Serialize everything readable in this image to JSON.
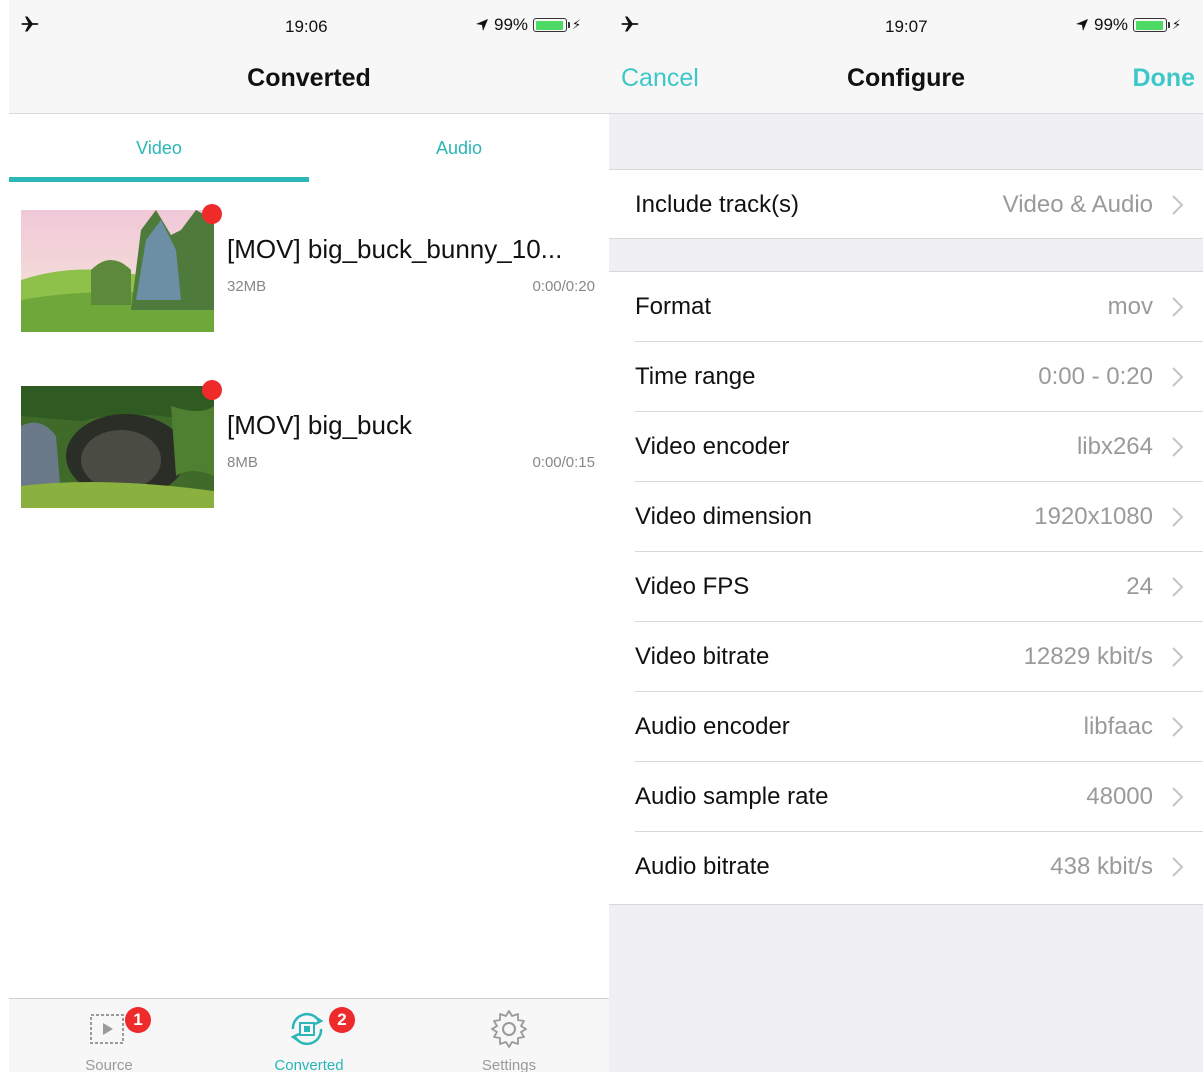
{
  "left_screen": {
    "status_bar": {
      "time": "19:06",
      "battery_percent": "99%"
    },
    "nav": {
      "title": "Converted"
    },
    "segments": [
      {
        "label": "Video",
        "selected": true
      },
      {
        "label": "Audio",
        "selected": false
      }
    ],
    "items": [
      {
        "title": "[MOV] big_buck_bunny_10...",
        "size": "32MB",
        "duration": "0:00/0:20",
        "unread": true
      },
      {
        "title": "[MOV] big_buck",
        "size": "8MB",
        "duration": "0:00/0:15",
        "unread": true
      }
    ],
    "tabbar": [
      {
        "label": "Source",
        "badge": "1",
        "icon": "film-play-icon",
        "active": false
      },
      {
        "label": "Converted",
        "badge": "2",
        "icon": "convert-icon",
        "active": true
      },
      {
        "label": "Settings",
        "badge": "",
        "icon": "gear-icon",
        "active": false
      }
    ]
  },
  "right_screen": {
    "status_bar": {
      "time": "19:07",
      "battery_percent": "99%"
    },
    "nav": {
      "cancel_label": "Cancel",
      "title": "Configure",
      "done_label": "Done"
    },
    "track_row": {
      "label": "Include track(s)",
      "value": "Video & Audio"
    },
    "settings": [
      {
        "label": "Format",
        "value": "mov"
      },
      {
        "label": "Time range",
        "value": "0:00 - 0:20"
      },
      {
        "label": "Video encoder",
        "value": "libx264"
      },
      {
        "label": "Video dimension",
        "value": "1920x1080"
      },
      {
        "label": "Video FPS",
        "value": "24"
      },
      {
        "label": "Video bitrate",
        "value": "12829 kbit/s"
      },
      {
        "label": "Audio encoder",
        "value": "libfaac"
      },
      {
        "label": "Audio sample rate",
        "value": "48000"
      },
      {
        "label": "Audio bitrate",
        "value": "438 kbit/s"
      }
    ]
  },
  "colors": {
    "accent": "#2bb6b8",
    "badge": "#ee2a2a",
    "battery": "#4cd964",
    "group_background": "#efeff4"
  }
}
